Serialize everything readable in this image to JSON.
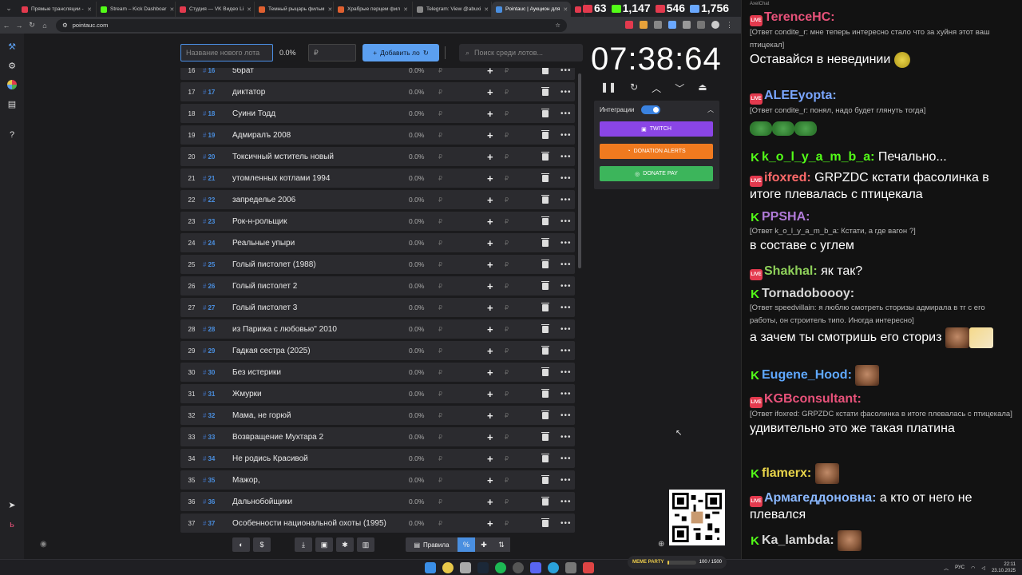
{
  "browser": {
    "tabs": [
      {
        "label": "Прямые трансляции -",
        "color": "#e33a4e"
      },
      {
        "label": "Stream – Kick Dashboar",
        "color": "#53fc18"
      },
      {
        "label": "Студия — VK Видео Li",
        "color": "#e33a4e"
      },
      {
        "label": "Темный рыцарь фильм",
        "color": "#e06030"
      },
      {
        "label": "Храбрые перцем фил",
        "color": "#e06030"
      },
      {
        "label": "Telegram: View @abuxi",
        "color": "#888"
      },
      {
        "label": "Pointauc | Аукцион для",
        "color": "#4a8fe0",
        "active": true
      },
      {
        "label": "",
        "color": "#e33a4e"
      }
    ],
    "url": "pointauc.com"
  },
  "overlay": {
    "counters": [
      {
        "value": "63",
        "color": "#e33a4e"
      },
      {
        "value": "1,147",
        "color": "#53fc18"
      },
      {
        "value": "546",
        "color": "#e33a4e"
      },
      {
        "value": "1,756",
        "color": "#6aa8ff"
      }
    ]
  },
  "sidebar": {
    "icons": [
      "hammer-icon",
      "gear-icon",
      "wheel-icon",
      "list-icon",
      "help-icon"
    ],
    "bottom_icons": [
      "telegram-icon",
      "brand-icon"
    ]
  },
  "controls": {
    "lot_name_placeholder": "Название нового лота",
    "percent": "0.0%",
    "amount_placeholder": "₽",
    "add_label": "Добавить ло",
    "search_placeholder": "Поиск среди лотов..."
  },
  "lots": [
    {
      "num": "16",
      "id": "16",
      "name": "5брат"
    },
    {
      "num": "17",
      "id": "17",
      "name": "диктатор"
    },
    {
      "num": "18",
      "id": "18",
      "name": "Суини Тодд"
    },
    {
      "num": "19",
      "id": "19",
      "name": "Адмиралъ 2008"
    },
    {
      "num": "20",
      "id": "20",
      "name": "Токсичный мститель новый"
    },
    {
      "num": "21",
      "id": "21",
      "name": " утомленных котлами 1994"
    },
    {
      "num": "22",
      "id": "22",
      "name": "запределье 2006"
    },
    {
      "num": "23",
      "id": "23",
      "name": "Рок-н-рольщик"
    },
    {
      "num": "24",
      "id": "24",
      "name": "Реальные упыри"
    },
    {
      "num": "25",
      "id": "25",
      "name": "Голый пистолет (1988)"
    },
    {
      "num": "26",
      "id": "26",
      "name": "Голый пистолет 2"
    },
    {
      "num": "27",
      "id": "27",
      "name": "Голый пистолет 3"
    },
    {
      "num": "28",
      "id": "28",
      "name": "из Парижа с любовью\" 2010"
    },
    {
      "num": "29",
      "id": "29",
      "name": "Гадкая сестра (2025)"
    },
    {
      "num": "30",
      "id": "30",
      "name": "Без истерики"
    },
    {
      "num": "31",
      "id": "31",
      "name": "Жмурки"
    },
    {
      "num": "32",
      "id": "32",
      "name": "Мама, не горюй"
    },
    {
      "num": "33",
      "id": "33",
      "name": "Возвращение Мухтара 2"
    },
    {
      "num": "34",
      "id": "34",
      "name": "Не родись Красивой"
    },
    {
      "num": "35",
      "id": "35",
      "name": "Мажор,"
    },
    {
      "num": "36",
      "id": "36",
      "name": "Дальнобойщики"
    },
    {
      "num": "37",
      "id": "37",
      "name": "Особенности национальной охоты (1995)"
    }
  ],
  "lot_percent": "0.0%",
  "currency": "₽",
  "timer": {
    "value": "07:38:64"
  },
  "integrations": {
    "title": "Интеграции",
    "buttons": [
      "TWITCH",
      "DONATION ALERTS",
      "DONATE PAY"
    ]
  },
  "bottom_toolbar": {
    "rules_label": "Правила"
  },
  "chat": {
    "title": "AxelChat",
    "messages": [
      {
        "platform": "live",
        "user": "TerenceHC:",
        "color": "#e8527a",
        "reply": "[Ответ condite_r: мне теперь интересно стало что за хуйня этот ваш птицекал]",
        "text": "Оставайся в невединии"
      },
      {
        "platform": "live",
        "user": "ALEEyopta:",
        "color": "#7aa6ff",
        "reply": "[Ответ condite_r: понял, надо будет глянуть тогда]",
        "text": ""
      },
      {
        "platform": "kick",
        "user": "k_o_l_y_a_m_b_a:",
        "color": "#53fc18",
        "reply": "",
        "text": "Печально..."
      },
      {
        "platform": "live",
        "user": "ifoxred:",
        "color": "#ff6a6a",
        "reply": "",
        "text": "GRPZDC кстати фасолинка в итоге плевалась с птицекала"
      },
      {
        "platform": "kick",
        "user": "PPSHA:",
        "color": "#b07ad8",
        "reply": "[Ответ k_o_l_y_a_m_b_a: Кстати, а где вагон ?]",
        "text": "в составе с углем"
      },
      {
        "platform": "live",
        "user": "Shakhal:",
        "color": "#8ed05a",
        "reply": "",
        "text": "як так?"
      },
      {
        "platform": "kick",
        "user": "Tornadoboooy:",
        "color": "#d6d6d6",
        "reply": "[Ответ speedvillain: я люблю смотреть сторизы адмирала в тг с его работы, он строитель типо. Иногда интересно]",
        "text": "а зачем ты смотришь его сториз"
      },
      {
        "platform": "kick",
        "user": "Eugene_Hood:",
        "color": "#5fa8ff",
        "reply": "",
        "text": ""
      },
      {
        "platform": "live",
        "user": "KGBconsultant:",
        "color": "#e8527a",
        "reply": "[Ответ ifoxred: GRPZDC кстати фасолинка в итоге плевалась с птицекала]",
        "text": "удивительно это же такая платина"
      },
      {
        "platform": "kick",
        "user": "flamerx:",
        "color": "#e8d44a",
        "reply": "",
        "text": ""
      },
      {
        "platform": "live",
        "user": "Армагеддоновна:",
        "color": "#8ab8ff",
        "reply": "",
        "text": "а кто от него не плевался"
      },
      {
        "platform": "kick",
        "user": "Ka_lambda:",
        "color": "#d6d6d6",
        "reply": "",
        "text": ""
      }
    ]
  },
  "taskbar": {
    "lang": "РУС",
    "time": "22:11",
    "date": "23.10.2025",
    "media_label": "MEME PARTY",
    "media_progress": "100 / 1500",
    "media_fill": 0.07
  }
}
